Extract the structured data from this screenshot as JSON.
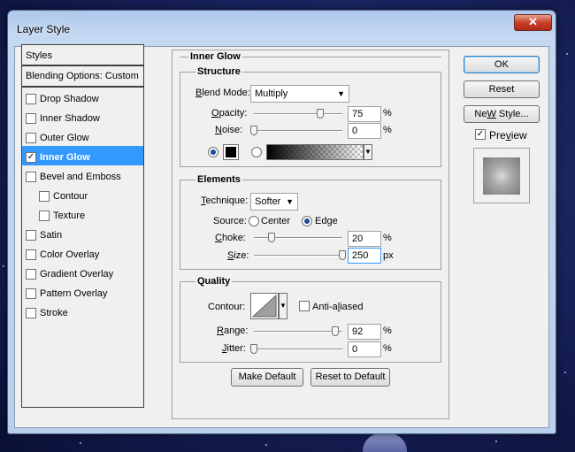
{
  "window": {
    "title": "Layer Style",
    "close_glyph": "✕"
  },
  "styles_panel": {
    "header": "Styles",
    "blending_options": "Blending Options: Custom",
    "items": [
      {
        "label": "Drop Shadow",
        "checked": false,
        "sub": false,
        "selected": false
      },
      {
        "label": "Inner Shadow",
        "checked": false,
        "sub": false,
        "selected": false
      },
      {
        "label": "Outer Glow",
        "checked": false,
        "sub": false,
        "selected": false
      },
      {
        "label": "Inner Glow",
        "checked": true,
        "sub": false,
        "selected": true
      },
      {
        "label": "Bevel and Emboss",
        "checked": false,
        "sub": false,
        "selected": false
      },
      {
        "label": "Contour",
        "checked": false,
        "sub": true,
        "selected": false
      },
      {
        "label": "Texture",
        "checked": false,
        "sub": true,
        "selected": false
      },
      {
        "label": "Satin",
        "checked": false,
        "sub": false,
        "selected": false
      },
      {
        "label": "Color Overlay",
        "checked": false,
        "sub": false,
        "selected": false
      },
      {
        "label": "Gradient Overlay",
        "checked": false,
        "sub": false,
        "selected": false
      },
      {
        "label": "Pattern Overlay",
        "checked": false,
        "sub": false,
        "selected": false
      },
      {
        "label": "Stroke",
        "checked": false,
        "sub": false,
        "selected": false
      }
    ]
  },
  "inner_glow": {
    "title": "Inner Glow",
    "structure": {
      "title": "Structure",
      "blend_mode_label_u": "B",
      "blend_mode_label_rest": "lend Mode:",
      "blend_mode_value": "Multiply",
      "opacity_label_u": "O",
      "opacity_label_rest": "pacity:",
      "opacity_value": "75",
      "opacity_unit": "%",
      "opacity_level": 0.75,
      "noise_label_u": "N",
      "noise_label_rest": "oise:",
      "noise_value": "0",
      "noise_unit": "%",
      "noise_level": 0,
      "color_selected": "solid",
      "glow_color": "#000000"
    },
    "elements": {
      "title": "Elements",
      "technique_label_u": "T",
      "technique_label_rest": "echnique:",
      "technique_value": "Softer",
      "source_label": "Source:",
      "source_center": "Center",
      "source_edge": "Edge",
      "source_selected": "edge",
      "choke_label_u": "C",
      "choke_label_rest": "hoke:",
      "choke_value": "20",
      "choke_unit": "%",
      "choke_level": 0.2,
      "size_label_u": "S",
      "size_label_rest": "ize:",
      "size_value": "250",
      "size_unit": "px",
      "size_level": 1.0
    },
    "quality": {
      "title": "Quality",
      "contour_label": "Contour:",
      "anti_aliased_label_pre": "Anti-a",
      "anti_aliased_label_u": "l",
      "anti_aliased_label_post": "iased",
      "anti_aliased_checked": false,
      "range_label_u": "R",
      "range_label_rest": "ange:",
      "range_value": "92",
      "range_unit": "%",
      "range_level": 0.92,
      "jitter_label_u": "J",
      "jitter_label_rest": "itter:",
      "jitter_value": "0",
      "jitter_unit": "%",
      "jitter_level": 0
    },
    "make_default": "Make Default",
    "reset_default": "Reset to Default"
  },
  "actions": {
    "ok": "OK",
    "reset": "Reset",
    "new_style_u": "W",
    "new_style_pre": "Ne",
    "new_style_post": " Style...",
    "preview_u": "v",
    "preview_pre": "Pre",
    "preview_post": "iew",
    "preview_checked": true
  },
  "colors": {
    "selection": "#3399ff",
    "accent": "#3c7fb1"
  }
}
